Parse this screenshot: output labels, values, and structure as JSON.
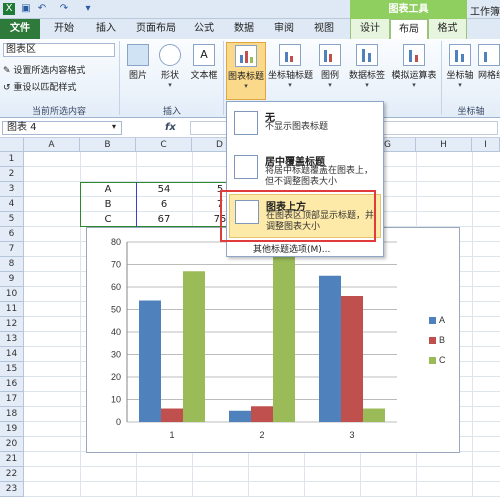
{
  "titlebar": {
    "context_tab": "图表工具",
    "workbook": "工作簿1"
  },
  "tabs": [
    "文件",
    "开始",
    "插入",
    "页面布局",
    "公式",
    "数据",
    "审阅",
    "视图",
    "设计",
    "布局",
    "格式"
  ],
  "ribbon": {
    "element_selector": "图表区",
    "format_selection": "设置所选内容格式",
    "reset_style": "重设以匹配样式",
    "group_current": "当前所选内容",
    "group_insert": "插入",
    "group_axes": "坐标轴",
    "buttons": [
      "图片",
      "形状",
      "文本框",
      "图表标题",
      "坐标轴标题",
      "图例",
      "数据标签",
      "模拟运算表",
      "坐标轴",
      "网格线"
    ]
  },
  "formula_bar": {
    "name_box": "图表 4",
    "fx": "fx"
  },
  "columns": [
    "A",
    "B",
    "C",
    "D",
    "E",
    "F",
    "G",
    "H",
    "I"
  ],
  "rows": [
    "1",
    "2",
    "3",
    "4",
    "5",
    "6",
    "7",
    "8",
    "9",
    "10",
    "11",
    "12",
    "13",
    "14",
    "15",
    "16",
    "17",
    "18",
    "19",
    "20",
    "21",
    "22",
    "23"
  ],
  "table": [
    [
      "A",
      "54",
      "5"
    ],
    [
      "B",
      "6",
      "7"
    ],
    [
      "C",
      "67",
      "75"
    ]
  ],
  "dropdown": {
    "none_title": "无",
    "none_desc": "不显示图表标题",
    "overlay_title": "居中覆盖标题",
    "overlay_desc": "将居中标题覆盖在图表上，但不调整图表大小",
    "above_title": "图表上方",
    "above_desc": "在图表区顶部显示标题，并调整图表大小",
    "more": "其他标题选项(M)..."
  },
  "chart_data": {
    "type": "bar",
    "categories": [
      "1",
      "2",
      "3"
    ],
    "series": [
      {
        "name": "A",
        "values": [
          54,
          5,
          65
        ],
        "color": "#4f81bd"
      },
      {
        "name": "B",
        "values": [
          6,
          7,
          56
        ],
        "color": "#c0504d"
      },
      {
        "name": "C",
        "values": [
          67,
          75,
          6
        ],
        "color": "#9bbb59"
      }
    ],
    "ylim": [
      0,
      80
    ],
    "yticks": [
      "0",
      "10",
      "20",
      "30",
      "40",
      "50",
      "60",
      "70",
      "80"
    ],
    "grid": true,
    "legend": "right"
  }
}
